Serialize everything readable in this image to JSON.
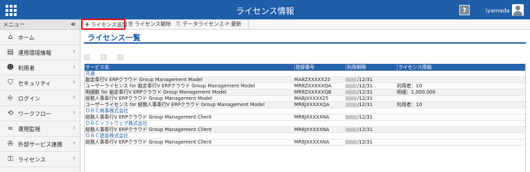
{
  "header": {
    "title": "ライセンス情報",
    "help_label": "?",
    "username": "iyamada"
  },
  "sidebar": {
    "menu_title": "メニュー",
    "collapse_label": "«",
    "items": [
      {
        "label": "ホーム",
        "icon": "home-icon",
        "glyph": "⌂",
        "chevron": ""
      },
      {
        "label": "運用環境情報",
        "icon": "clipboard-icon",
        "glyph": "▤",
        "chevron": "›"
      },
      {
        "label": "利用者",
        "icon": "users-icon",
        "glyph": "☻",
        "chevron": "›"
      },
      {
        "label": "セキュリティ",
        "icon": "shield-icon",
        "glyph": "⛉",
        "chevron": "›"
      },
      {
        "label": "ログイン",
        "icon": "login-icon",
        "glyph": "⎆",
        "chevron": "›"
      },
      {
        "label": "ワークフロー",
        "icon": "workflow-icon",
        "glyph": "⟲",
        "chevron": "›"
      },
      {
        "label": "運用監視",
        "icon": "binoculars-icon",
        "glyph": "∞",
        "chevron": "›"
      },
      {
        "label": "外部サービス連携",
        "icon": "plugin-icon",
        "glyph": "✇",
        "chevron": "›"
      },
      {
        "label": "ライセンス",
        "icon": "key-icon",
        "glyph": "⚿",
        "chevron": "›"
      }
    ]
  },
  "toolbar": {
    "add_label": "ライセンス追加",
    "add_glyph": "+",
    "remove_label": "ライセンス解除",
    "remove_glyph": "🗑",
    "data_label": "データライセンス",
    "data_glyph": "⎘",
    "refresh_label": "最新",
    "refresh_glyph": "⟳",
    "highlight_color": "#e60012"
  },
  "page": {
    "title": "ライセンス一覧",
    "accent_color": "#1f5ea8"
  },
  "pager": {
    "first": "‹",
    "page": "1",
    "next": "›"
  },
  "table": {
    "headers": [
      "サービス名",
      "登録番号",
      "利用期限",
      "ライセンス情報"
    ],
    "rows": [
      {
        "kind": "group",
        "name": "共通"
      },
      {
        "kind": "data",
        "name": "勘定奉行V ERPクラウド Group Management Model",
        "reg": "MA8ZXXXXX25",
        "expiry": "/12/31",
        "info": ""
      },
      {
        "kind": "data",
        "name": "ユーザーライセンス for 勘定奉行V ERPクラウド Group Management Model",
        "reg": "MR8ZXXXXXQA",
        "expiry": "/12/31",
        "info": "利用者：10"
      },
      {
        "kind": "data",
        "name": "明細数 for 勘定奉行V ERPクラウド Group Management Model",
        "reg": "MR8ZXXXXXQB",
        "expiry": "/12/31",
        "info": "明細：1,000,000"
      },
      {
        "kind": "data",
        "name": "総務人事奉行V ERPクラウド Group Management Model",
        "reg": "MA8JXXXXX25",
        "expiry": "/12/31",
        "info": ""
      },
      {
        "kind": "data",
        "name": "ユーザーライセンス for 総務人事奉行V ERPクラウド Group Management Model",
        "reg": "MR8JXXXXXQA",
        "expiry": "/12/31",
        "info": "利用者：10"
      },
      {
        "kind": "group",
        "name": "ＯＢＣ商事株式会社"
      },
      {
        "kind": "data",
        "name": "総務人事奉行V ERPクラウド Group Management Client",
        "reg": "MR8JXXXXXNA",
        "expiry": "/12/31",
        "info": ""
      },
      {
        "kind": "group",
        "name": "ＯＢＣソフトウェア株式会社"
      },
      {
        "kind": "data",
        "name": "総務人事奉行V ERPクラウド Group Management Client",
        "reg": "MR8JXXXXXNA",
        "expiry": "/12/31",
        "info": ""
      },
      {
        "kind": "group",
        "name": "ＯＢＣ建設株式会社"
      },
      {
        "kind": "data",
        "name": "総務人事奉行V ERPクラウド Group Management Client",
        "reg": "MR8JXXXXXNA",
        "expiry": "/12/31",
        "info": ""
      }
    ]
  }
}
